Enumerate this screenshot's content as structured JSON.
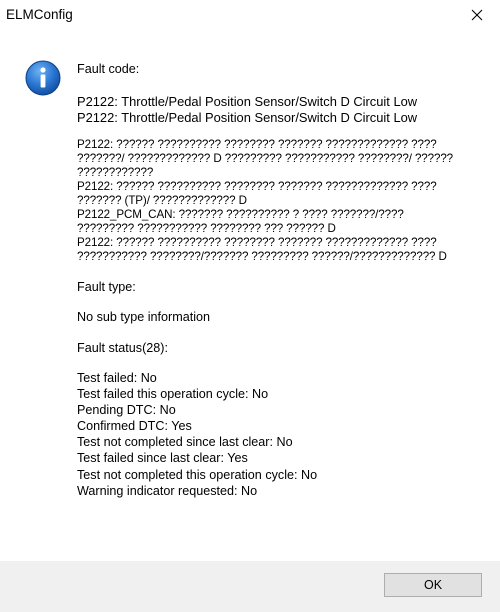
{
  "window": {
    "title": "ELMConfig",
    "close_icon": "close-icon"
  },
  "message": {
    "icon": "info-icon",
    "fault_code_label": "Fault code:",
    "codes": [
      "P2122: Throttle/Pedal Position Sensor/Switch D Circuit Low",
      "P2122: Throttle/Pedal Position Sensor/Switch D Circuit Low"
    ],
    "descriptions": [
      "P2122: ?????? ?????????? ???????? ??????? ????????????? ????",
      "???????/ ????????????? D ????????? ??????????? ????????/ ??????",
      "????????????",
      "P2122: ?????? ?????????? ???????? ??????? ????????????? ????",
      "??????? (TP)/ ????????????? D",
      "P2122_PCM_CAN: ??????? ?????????? ? ???? ???????/????",
      "????????? ??????????? ???????? ??? ?????? D",
      "P2122: ?????? ?????????? ???????? ??????? ????????????? ????",
      "??????????? ????????/??????? ????????? ??????/????????????? D"
    ],
    "fault_type_label": "Fault type:",
    "sub_type": "No sub type information",
    "fault_status_label": "Fault status(28):",
    "status_lines": [
      "Test failed: No",
      "Test failed this operation cycle: No",
      "Pending DTC: No",
      "Confirmed DTC: Yes",
      "Test not completed since last clear: No",
      "Test failed since last clear: Yes",
      "Test not completed this operation cycle: No",
      "Warning indicator requested: No"
    ]
  },
  "footer": {
    "ok_label": "OK"
  },
  "colors": {
    "icon_blue": "#1e6fc6",
    "footer_bg": "#f0f0f0",
    "button_bg": "#e1e1e1",
    "button_border": "#adadad"
  }
}
